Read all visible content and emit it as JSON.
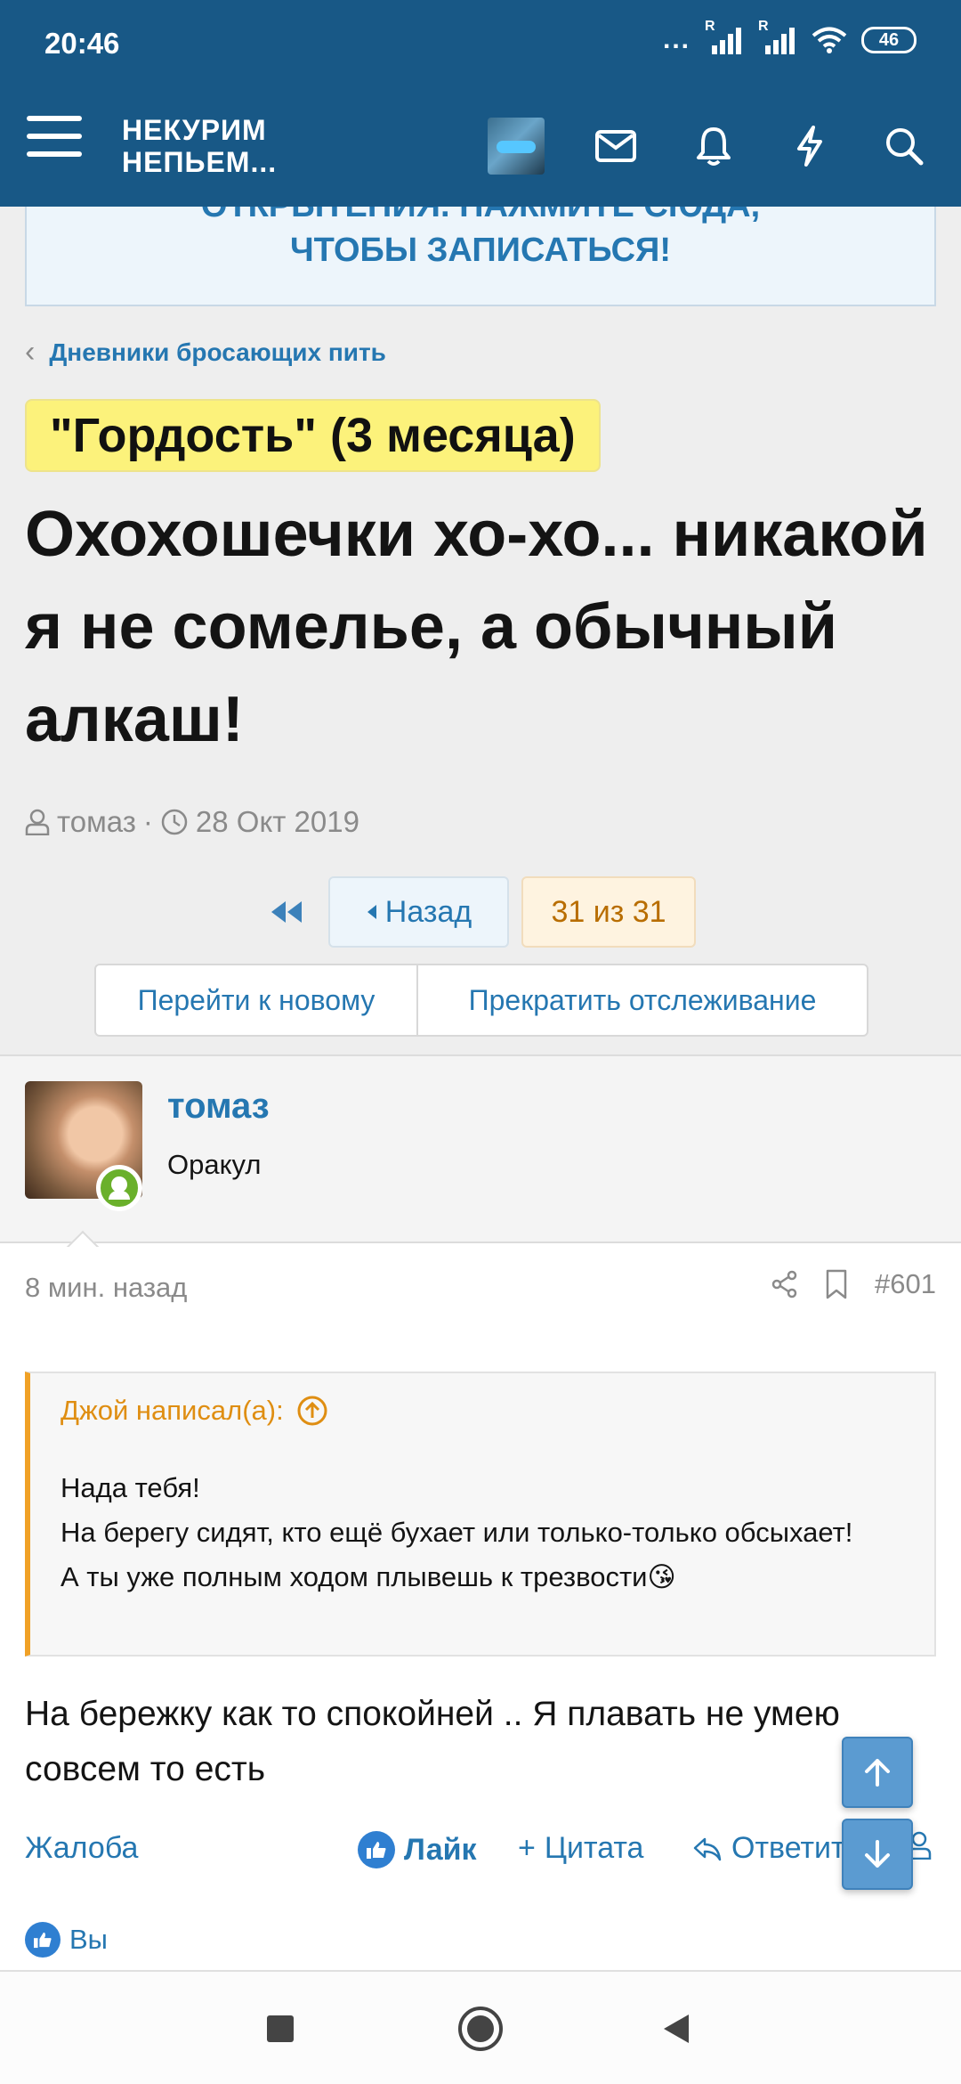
{
  "status_bar": {
    "time": "20:46",
    "dots": "...",
    "signal1_tag": "R",
    "signal2_tag": "R",
    "battery": "46"
  },
  "app_header": {
    "logo_line1": "НЕКУРИМ",
    "logo_line2": "НЕПЬЕМ...",
    "icons": [
      "menu-icon",
      "envelope-icon",
      "bell-icon",
      "bolt-icon",
      "search-icon"
    ]
  },
  "banner": {
    "cut_text": "ОТКРЫТЕНИЯ. НАЖМИТЕ СЮДА,",
    "text": "ЧТОБЫ ЗАПИСАТЬСЯ!"
  },
  "breadcrumb": {
    "label": "Дневники бросающих пить"
  },
  "thread": {
    "prefix": "\"Гордость\" (3 месяца)",
    "title": "Охохошечки хо-хо... никакой я не сомелье, а обычный алкаш!",
    "author": "томаз",
    "separator": "·",
    "date": "28 Окт 2019"
  },
  "pagination": {
    "back_label": "Назад",
    "current": "31 из 31"
  },
  "thread_actions": {
    "goto_new": "Перейти к новому",
    "unwatch": "Прекратить отслеживание"
  },
  "post": {
    "username": "томаз",
    "user_title": "Оракул",
    "time": "8 мин. назад",
    "number": "#601",
    "quote_author": "Джой написал(а):",
    "quote_lines": [
      "Нада тебя!",
      "На берегу сидят, кто ещё бухает или только-только обсыхает!",
      "А ты уже полным ходом плывешь к трезвости😘"
    ],
    "message": "На бережку как то спокойней .. Я плавать не умею совсем то есть",
    "actions": {
      "report": "Жалоба",
      "like": "Лайк",
      "quote": "Цитата",
      "reply": "Ответить"
    },
    "liked_by": "Вы"
  },
  "colors": {
    "header_bg": "#185886",
    "link": "#2577b1",
    "accent_quote": "#f0a126",
    "prefix_bg": "#fcf27b"
  }
}
